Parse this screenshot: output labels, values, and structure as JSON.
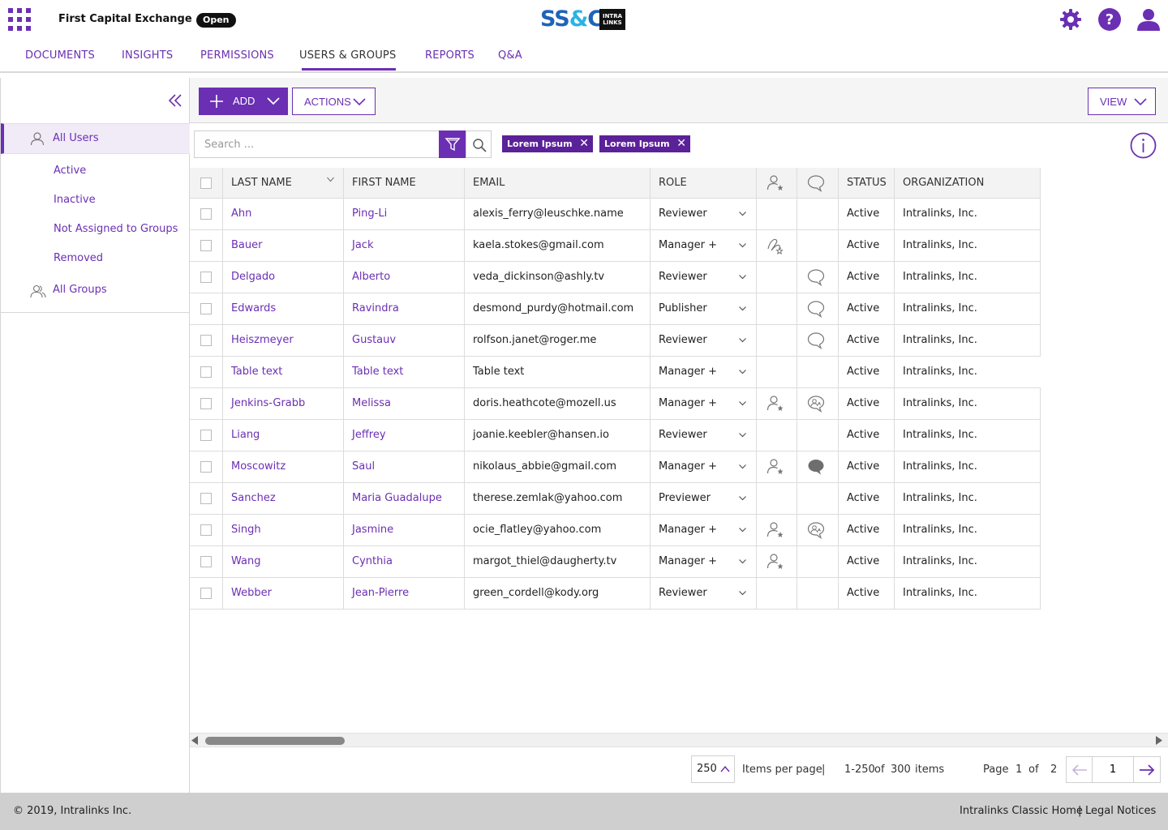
{
  "header": {
    "exchange_name": "First Capital Exchange",
    "status": "Open",
    "logo_text": "SS&C",
    "logo_badge": "INTRALINKS"
  },
  "tabs": [
    {
      "label": "DOCUMENTS",
      "active": false
    },
    {
      "label": "INSIGHTS",
      "active": false
    },
    {
      "label": "PERMISSIONS",
      "active": false
    },
    {
      "label": "USERS & GROUPS",
      "active": true
    },
    {
      "label": "REPORTS",
      "active": false
    },
    {
      "label": "Q&A",
      "active": false
    }
  ],
  "sidebar": {
    "all_users": "All Users",
    "filters": [
      "Active",
      "Inactive",
      "Not Assigned to Groups",
      "Removed"
    ],
    "all_groups": "All Groups"
  },
  "toolbar": {
    "add_label": "ADD",
    "actions_label": "ACTIONS",
    "view_label": "VIEW"
  },
  "search": {
    "placeholder": "Search ...",
    "chips": [
      "Lorem Ipsum",
      "Lorem Ipsum"
    ]
  },
  "table": {
    "columns": [
      "LAST NAME",
      "FIRST NAME",
      "EMAIL",
      "ROLE",
      "STATUS",
      "ORGANIZATION"
    ],
    "rows": [
      {
        "last": "Ahn",
        "first": "Ping-Li",
        "email": "alexis_ferry@leuschke.name",
        "role": "Reviewer",
        "user_icon": "",
        "comment_icon": "",
        "status": "Active",
        "org": "Intralinks, Inc."
      },
      {
        "last": "Bauer",
        "first": "Jack",
        "email": "kaela.stokes@gmail.com",
        "role": "Manager +",
        "user_icon": "signature-star-icon",
        "comment_icon": "",
        "status": "Active",
        "org": "Intralinks, Inc."
      },
      {
        "last": "Delgado",
        "first": "Alberto",
        "email": "veda_dickinson@ashly.tv",
        "role": "Reviewer",
        "user_icon": "",
        "comment_icon": "comment-icon",
        "status": "Active",
        "org": "Intralinks, Inc."
      },
      {
        "last": "Edwards",
        "first": "Ravindra",
        "email": "desmond_purdy@hotmail.com",
        "role": "Publisher",
        "user_icon": "",
        "comment_icon": "comment-icon",
        "status": "Active",
        "org": "Intralinks, Inc."
      },
      {
        "last": "Heiszmeyer",
        "first": "Gustauv",
        "email": "rolfson.janet@roger.me",
        "role": "Reviewer",
        "user_icon": "",
        "comment_icon": "comment-icon",
        "status": "Active",
        "org": "Intralinks, Inc."
      },
      {
        "last": "Table text",
        "first": "Table text",
        "email": "Table text",
        "role": "Manager +",
        "user_icon": "",
        "comment_icon": "",
        "status": "Active",
        "org": "Intralinks, Inc."
      },
      {
        "last": "Jenkins-Grabb",
        "first": "Melissa",
        "email": "doris.heathcote@mozell.us",
        "role": "Manager +",
        "user_icon": "user-star-icon",
        "comment_icon": "comment-person-icon",
        "status": "Active",
        "org": "Intralinks, Inc."
      },
      {
        "last": "Liang",
        "first": "Jeffrey",
        "email": "joanie.keebler@hansen.io",
        "role": "Reviewer",
        "user_icon": "",
        "comment_icon": "",
        "status": "Active",
        "org": "Intralinks, Inc."
      },
      {
        "last": "Moscowitz",
        "first": "Saul",
        "email": "nikolaus_abbie@gmail.com",
        "role": "Manager +",
        "user_icon": "user-star-icon",
        "comment_icon": "comment-filled-icon",
        "status": "Active",
        "org": "Intralinks, Inc."
      },
      {
        "last": "Sanchez",
        "first": "Maria Guadalupe",
        "email": "therese.zemlak@yahoo.com",
        "role": "Previewer",
        "user_icon": "",
        "comment_icon": "",
        "status": "Active",
        "org": "Intralinks, Inc."
      },
      {
        "last": "Singh",
        "first": "Jasmine",
        "email": "ocie_flatley@yahoo.com",
        "role": "Manager +",
        "user_icon": "user-star-icon",
        "comment_icon": "comment-person-icon",
        "status": "Active",
        "org": "Intralinks, Inc."
      },
      {
        "last": "Wang",
        "first": "Cynthia",
        "email": "margot_thiel@daugherty.tv",
        "role": "Manager +",
        "user_icon": "user-star-icon",
        "comment_icon": "",
        "status": "Active",
        "org": "Intralinks, Inc."
      },
      {
        "last": "Webber",
        "first": "Jean-Pierre",
        "email": "green_cordell@kody.org",
        "role": "Reviewer",
        "user_icon": "",
        "comment_icon": "",
        "status": "Active",
        "org": "Intralinks, Inc."
      }
    ]
  },
  "pagination": {
    "per_page": "250",
    "per_page_label": "Items per page",
    "sep": "|",
    "range": "1-250",
    "of_label": "of",
    "total": "300",
    "items_label": "items",
    "page_label": "Page",
    "current_page": "1",
    "page_of": "of",
    "total_pages": "2",
    "page_input": "1"
  },
  "footer": {
    "copyright": "© 2019, Intralinks Inc.",
    "classic_home": "Intralinks Classic Home",
    "separator": "|",
    "legal": "Legal Notices"
  },
  "colors": {
    "accent": "#6b2fb3",
    "chip": "#5b2199",
    "footer": "#cfcfcf"
  }
}
